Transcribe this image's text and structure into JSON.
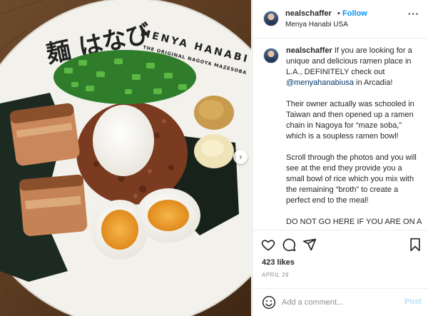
{
  "photo": {
    "alt_name": "ramen-photo",
    "bowl_logo_jp": "麺 はなび",
    "bowl_brand": "MENYA HANABI",
    "bowl_subtitle": "THE ORIGINAL NAGOYA MAZESOBA"
  },
  "header": {
    "username": "nealschaffer",
    "separator": "•",
    "follow_label": "Follow",
    "location": "Menya Hanabi USA",
    "more_icon": "···"
  },
  "caption": {
    "username": "nealschaffer",
    "p1_text": " If you are looking for a unique and delicious ramen place in L.A., DEFINITELY check out ",
    "p1_mention": "@menyahanabiusa",
    "p1_tail": " in Arcadia!",
    "p2": "Their owner actually was schooled in Taiwan and then opened up a ramen chain in Nagoya for “maze soba,” which is a soupless ramen bowl!",
    "p3": "Scroll through the photos and you will see at the end they provide you a small bowl of rice which you mix with the remaining “broth” to create a perfect end to the meal!",
    "p4": "DO NOT GO HERE IF YOU ARE ON A DIET! lol"
  },
  "stats": {
    "likes": "423 likes",
    "date": "APRIL 29"
  },
  "comment": {
    "placeholder": "Add a comment...",
    "post_label": "Post"
  },
  "icons": {
    "like": "heart-icon",
    "comment": "comment-icon",
    "share": "share-icon",
    "save": "bookmark-icon",
    "emoji": "emoji-icon",
    "next": "chevron-right-icon"
  },
  "colors": {
    "follow": "#0095f6",
    "post_disabled": "#b2dffc",
    "mention": "#00376b",
    "muted": "#8e8e8e"
  }
}
